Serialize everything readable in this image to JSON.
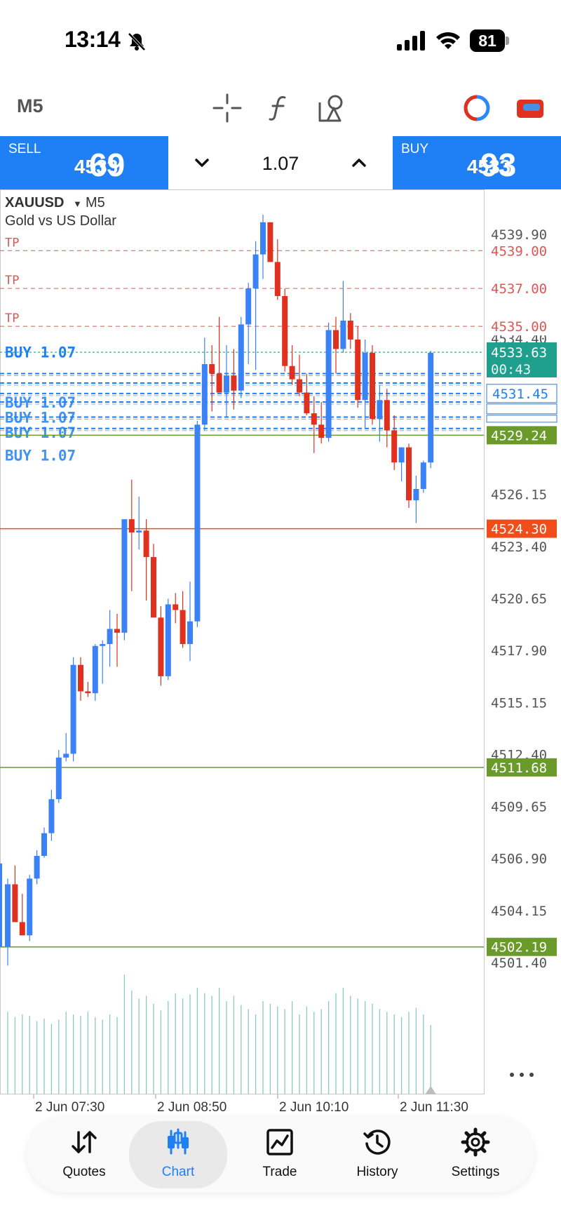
{
  "status_bar": {
    "time": "13:14",
    "battery": "81"
  },
  "toolbar": {
    "timeframe": "M5"
  },
  "trade_panel": {
    "sell": {
      "label": "SELL",
      "price_small": "4533.",
      "price_big": "69"
    },
    "buy": {
      "label": "BUY",
      "price_small": "4533.",
      "price_big": "93"
    },
    "lot": "1.07"
  },
  "chart": {
    "symbol": "XAUUSD",
    "timeframe": "M5",
    "description": "Gold vs US Dollar",
    "colors": {
      "bull": "#3b82f6",
      "bear": "#e0301e",
      "tp": "#e05555",
      "order": "#1f7ff5",
      "ask": "#1fa08e",
      "green": "#6a9a2a",
      "orange": "#f04d1a"
    },
    "tp_labels": [
      "TP",
      "TP",
      "TP"
    ],
    "order_labels": [
      "BUY 1.07",
      "BUY 1.07",
      "BUY 1.07",
      "BUY 1.07",
      "BUY 1.07"
    ],
    "price_ticks": [
      "4539.90",
      "4534.40",
      "4526.15",
      "4523.40",
      "4520.65",
      "4517.90",
      "4515.15",
      "4512.40",
      "4509.65",
      "4506.90",
      "4504.15",
      "4501.40"
    ],
    "level_tags": [
      {
        "text": "4539.00",
        "kind": "tp"
      },
      {
        "text": "4537.00",
        "kind": "tp"
      },
      {
        "text": "4535.00",
        "kind": "tp"
      },
      {
        "text": "4533.63",
        "kind": "ask"
      },
      {
        "text": "00:43",
        "kind": "timer"
      },
      {
        "text": "4531.45",
        "kind": "order"
      },
      {
        "text": "4529.24",
        "kind": "green"
      },
      {
        "text": "4524.30",
        "kind": "orange"
      },
      {
        "text": "4511.68",
        "kind": "green"
      },
      {
        "text": "4502.19",
        "kind": "green"
      }
    ],
    "time_labels": [
      "2 Jun 07:30",
      "2 Jun 08:50",
      "2 Jun 10:10",
      "2 Jun 11:30"
    ]
  },
  "chart_data": {
    "type": "candlestick",
    "symbol": "XAUUSD",
    "timeframe": "M5",
    "ylim": [
      4500.5,
      4541.5
    ],
    "candles": [
      [
        4502.2,
        4505.8,
        4501.2,
        4505.5
      ],
      [
        4505.5,
        4506.5,
        4503.5,
        4503.5
      ],
      [
        4503.5,
        4505.0,
        4502.8,
        4502.8
      ],
      [
        4502.8,
        4506.0,
        4502.5,
        4505.8
      ],
      [
        4505.8,
        4507.3,
        4505.5,
        4507.0
      ],
      [
        4507.0,
        4508.5,
        4506.9,
        4508.2
      ],
      [
        4508.2,
        4510.5,
        4507.8,
        4510.0
      ],
      [
        4510.0,
        4512.6,
        4509.8,
        4512.2
      ],
      [
        4512.2,
        4513.5,
        4512.0,
        4512.4
      ],
      [
        4512.4,
        4517.5,
        4512.0,
        4517.1
      ],
      [
        4517.1,
        4517.5,
        4515.2,
        4515.7
      ],
      [
        4515.7,
        4516.2,
        4515.4,
        4515.6
      ],
      [
        4515.6,
        4518.2,
        4515.2,
        4518.1
      ],
      [
        4518.1,
        4518.4,
        4516.1,
        4518.2
      ],
      [
        4518.2,
        4520.0,
        4517.0,
        4519.0
      ],
      [
        4519.0,
        4519.8,
        4517.0,
        4518.8
      ],
      [
        4518.8,
        4524.8,
        4518.4,
        4524.8
      ],
      [
        4524.8,
        4526.9,
        4521.0,
        4524.1
      ],
      [
        4524.1,
        4526.0,
        4523.2,
        4524.2
      ],
      [
        4524.2,
        4524.8,
        4520.5,
        4522.8
      ],
      [
        4522.8,
        4523.5,
        4519.7,
        4519.6
      ],
      [
        4519.6,
        4520.2,
        4516.0,
        4516.5
      ],
      [
        4516.5,
        4520.6,
        4516.3,
        4520.3
      ],
      [
        4520.3,
        4520.9,
        4519.3,
        4520.0
      ],
      [
        4520.0,
        4521.0,
        4518.0,
        4518.2
      ],
      [
        4518.2,
        4521.5,
        4517.3,
        4519.4
      ],
      [
        4519.4,
        4530.0,
        4519.1,
        4529.8
      ],
      [
        4529.8,
        4534.4,
        4529.5,
        4533.0
      ],
      [
        4533.0,
        4534.0,
        4530.5,
        4532.5
      ],
      [
        4532.5,
        4535.5,
        4531.5,
        4531.5
      ],
      [
        4531.5,
        4534.0,
        4530.2,
        4532.4
      ],
      [
        4532.4,
        4533.8,
        4530.6,
        4531.6
      ],
      [
        4531.6,
        4535.5,
        4531.2,
        4535.1
      ],
      [
        4535.1,
        4537.3,
        4533.0,
        4537.0
      ],
      [
        4537.0,
        4539.5,
        4532.7,
        4538.8
      ],
      [
        4538.8,
        4540.9,
        4537.5,
        4540.5
      ],
      [
        4540.5,
        4539.8,
        4538.4,
        4538.4
      ],
      [
        4538.4,
        4539.6,
        4536.4,
        4536.6
      ],
      [
        4536.6,
        4537.0,
        4532.6,
        4532.9
      ],
      [
        4532.9,
        4534.0,
        4531.9,
        4532.2
      ],
      [
        4532.2,
        4533.5,
        4531.3,
        4531.5
      ],
      [
        4531.5,
        4532.5,
        4530.3,
        4530.4
      ],
      [
        4530.4,
        4531.3,
        4528.3,
        4529.8
      ],
      [
        4529.8,
        4531.0,
        4528.8,
        4529.1
      ],
      [
        4529.1,
        4535.2,
        4528.9,
        4534.8
      ],
      [
        4534.8,
        4535.5,
        4532.5,
        4533.8
      ],
      [
        4533.8,
        4537.4,
        4533.6,
        4535.3
      ],
      [
        4535.3,
        4535.7,
        4533.8,
        4534.3
      ],
      [
        4534.3,
        4535.0,
        4530.7,
        4531.1
      ],
      [
        4531.1,
        4534.3,
        4529.6,
        4533.6
      ],
      [
        4533.6,
        4534.0,
        4529.8,
        4530.1
      ],
      [
        4530.1,
        4531.9,
        4528.9,
        4531.1
      ],
      [
        4531.1,
        4531.7,
        4528.6,
        4529.5
      ],
      [
        4529.5,
        4530.3,
        4527.4,
        4527.8
      ],
      [
        4527.8,
        4528.6,
        4526.8,
        4528.6
      ],
      [
        4528.6,
        4528.8,
        4525.4,
        4525.8
      ],
      [
        4525.8,
        4527.1,
        4524.6,
        4526.4
      ],
      [
        4526.4,
        4527.9,
        4526.2,
        4527.8
      ],
      [
        4527.8,
        4533.7,
        4527.5,
        4533.6
      ]
    ],
    "volumes": [
      0.62,
      0.58,
      0.6,
      0.59,
      0.55,
      0.57,
      0.53,
      0.56,
      0.62,
      0.6,
      0.59,
      0.62,
      0.58,
      0.56,
      0.6,
      0.58,
      0.9,
      0.78,
      0.72,
      0.74,
      0.68,
      0.63,
      0.7,
      0.76,
      0.72,
      0.75,
      0.8,
      0.76,
      0.74,
      0.8,
      0.7,
      0.74,
      0.67,
      0.64,
      0.6,
      0.7,
      0.68,
      0.66,
      0.64,
      0.7,
      0.6,
      0.66,
      0.62,
      0.64,
      0.7,
      0.76,
      0.8,
      0.74,
      0.72,
      0.7,
      0.68,
      0.64,
      0.62,
      0.6,
      0.58,
      0.62,
      0.65,
      0.6,
      0.52
    ],
    "tp_levels": [
      4539.0,
      4537.0,
      4535.0
    ],
    "order_levels": [
      4531.45,
      4532.5,
      4532.0,
      4531.0,
      4530.2,
      4529.6
    ],
    "ask": 4533.63,
    "horizontal_lines": [
      4529.24,
      4524.3,
      4511.68,
      4502.19
    ]
  },
  "bottom_nav": [
    {
      "label": "Quotes",
      "icon": "quotes-arrows-icon"
    },
    {
      "label": "Chart",
      "icon": "candles-icon",
      "active": true
    },
    {
      "label": "Trade",
      "icon": "trade-chart-icon"
    },
    {
      "label": "History",
      "icon": "history-clock-icon"
    },
    {
      "label": "Settings",
      "icon": "gear-icon"
    }
  ]
}
